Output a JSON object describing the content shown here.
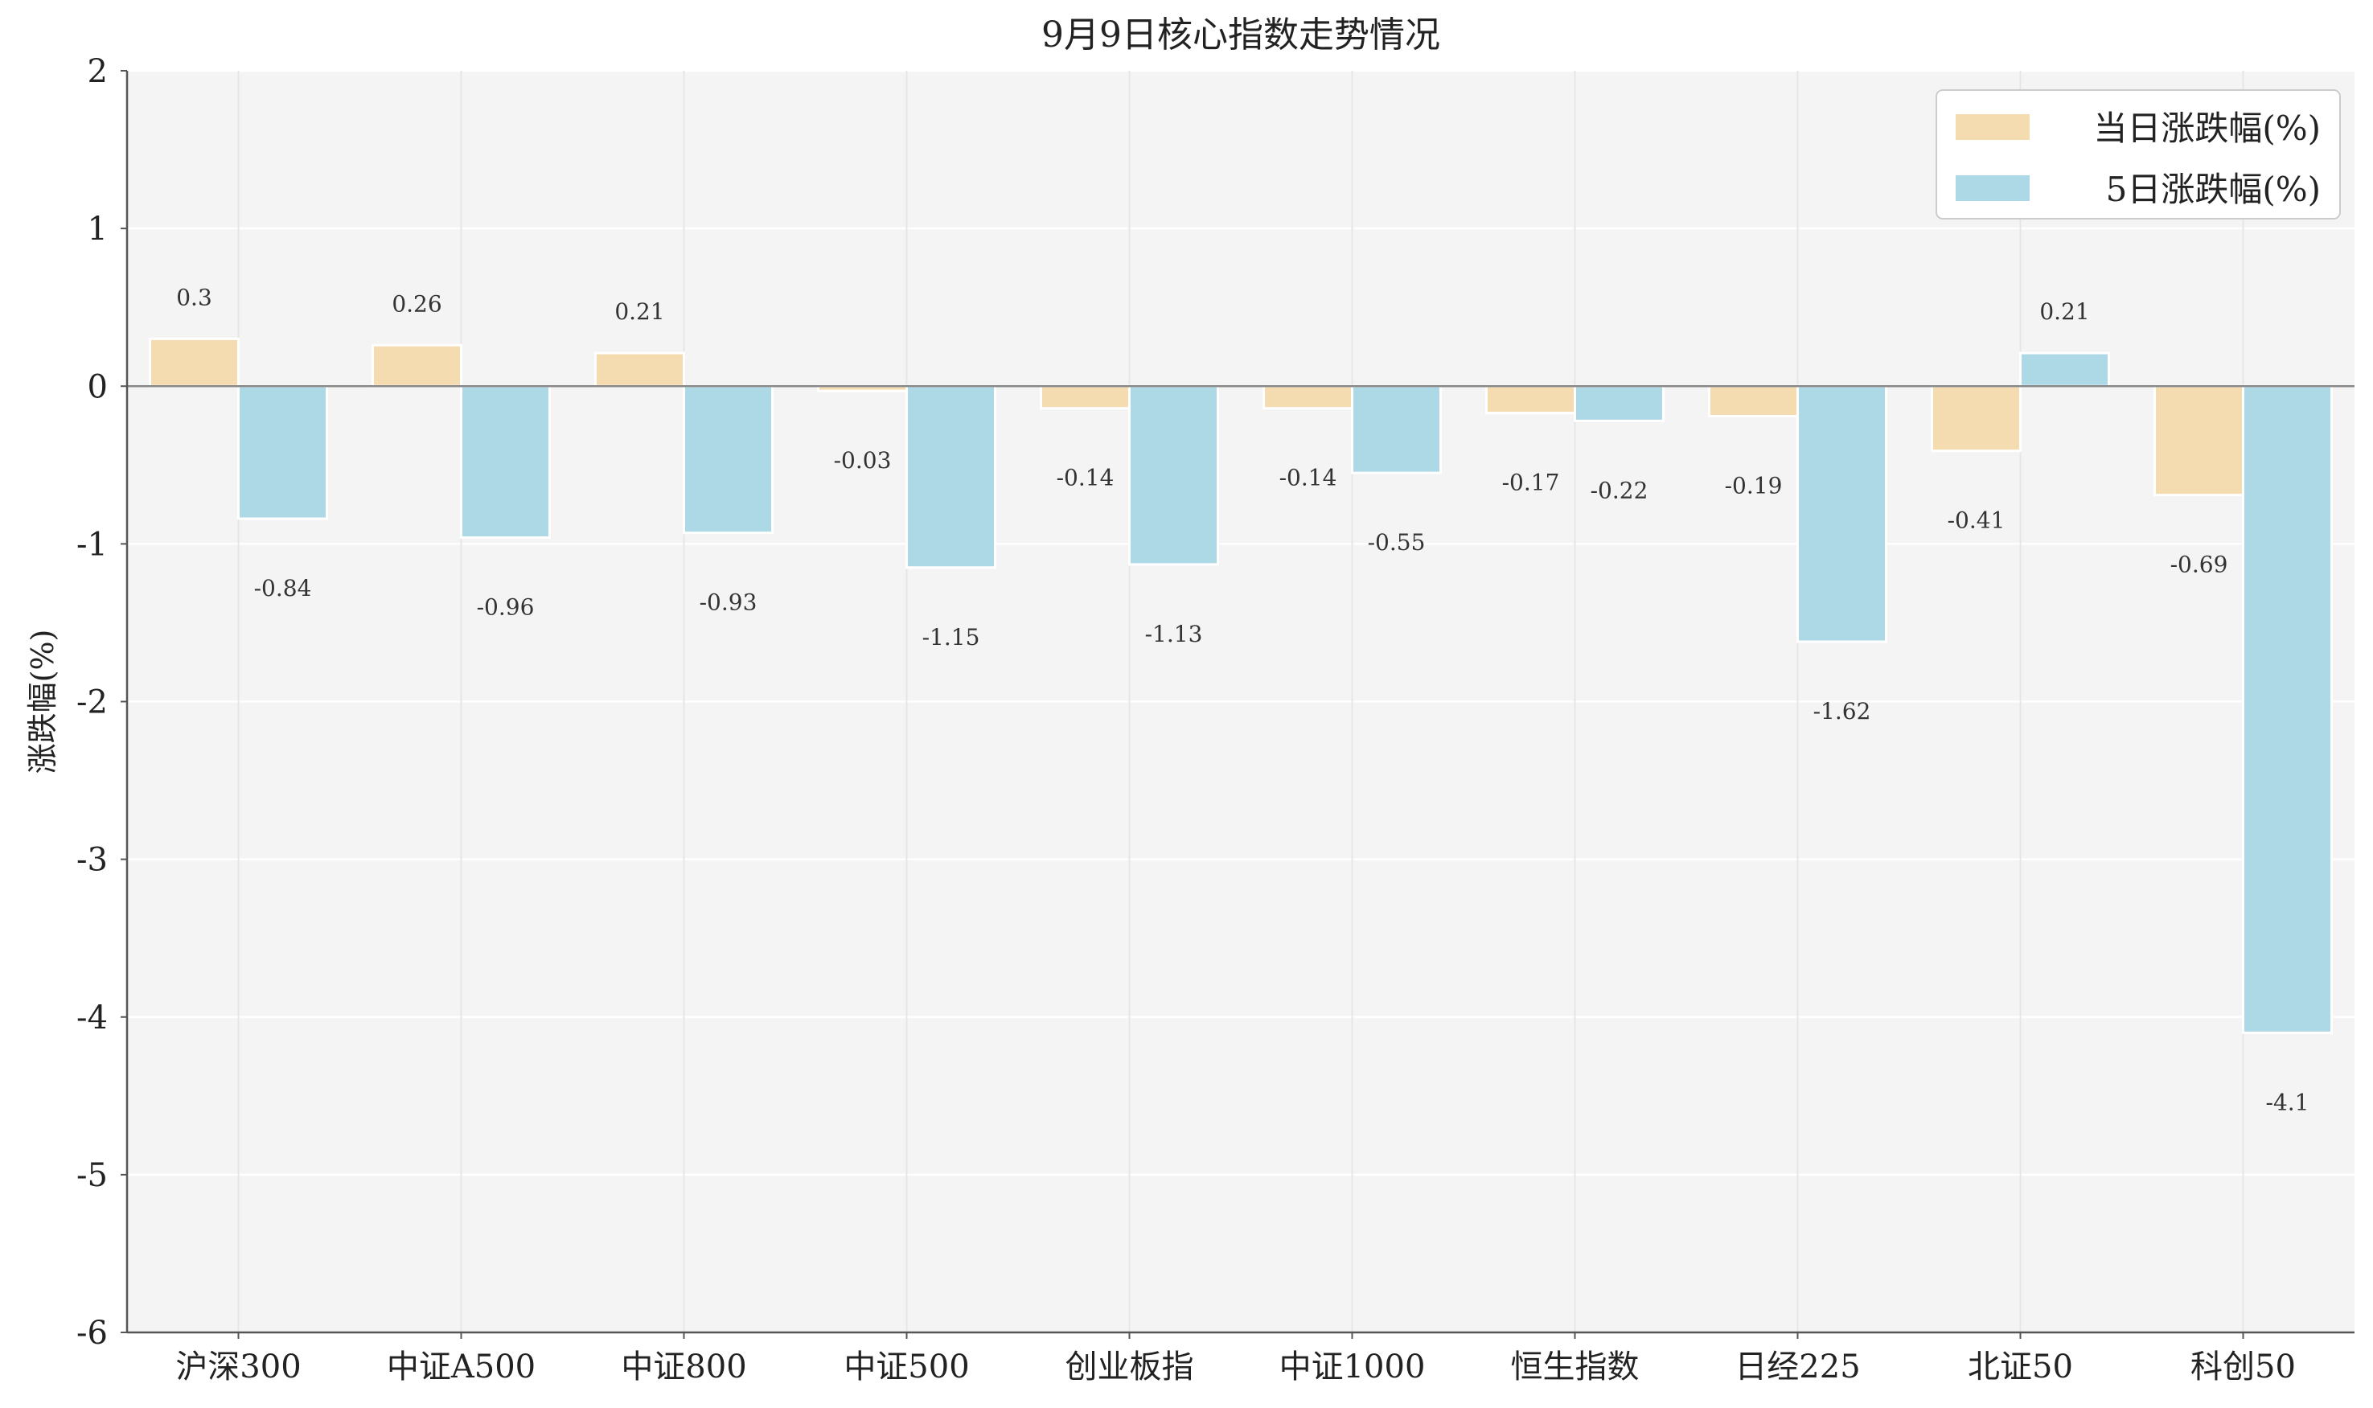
{
  "chart_data": {
    "type": "bar",
    "title": "9月9日核心指数走势情况",
    "xlabel": "",
    "ylabel": "涨跌幅(%)",
    "ylim": [
      -6,
      2
    ],
    "yticks": [
      2,
      1,
      0,
      -1,
      -2,
      -3,
      -4,
      -5,
      -6
    ],
    "grid": true,
    "legend_position": "top-right",
    "categories": [
      "沪深300",
      "中证A500",
      "中证800",
      "中证500",
      "创业板指",
      "中证1000",
      "恒生指数",
      "日经225",
      "北证50",
      "科创50"
    ],
    "series": [
      {
        "name": "当日涨跌幅(%)",
        "color": "#F5DCB0",
        "values": [
          0.3,
          0.26,
          0.21,
          -0.03,
          -0.14,
          -0.14,
          -0.17,
          -0.19,
          -0.41,
          -0.69
        ]
      },
      {
        "name": "5日涨跌幅(%)",
        "color": "#ADD8E6",
        "values": [
          -0.84,
          -0.96,
          -0.93,
          -1.15,
          -1.13,
          -0.55,
          -0.22,
          -1.62,
          0.21,
          -4.1
        ]
      }
    ]
  },
  "colors": {
    "plot_background": "#F4F4F4",
    "grid": "#FFFFFF",
    "vgrid": "#E6E6E6",
    "axis": "#555555",
    "zero_line": "#888888"
  }
}
